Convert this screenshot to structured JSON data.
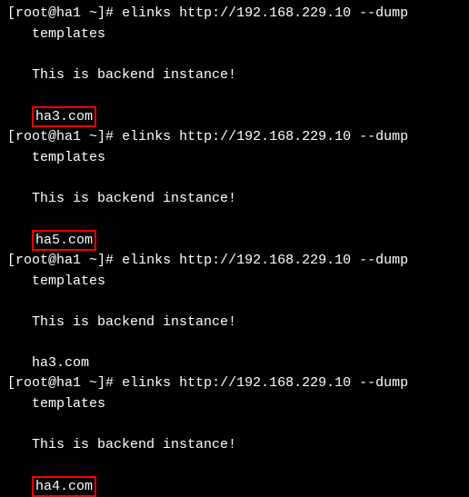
{
  "prompt": {
    "open_bracket": "[",
    "user_host": "root@ha1 ~",
    "close_bracket": "]#",
    "command": "elinks http://192.168.229.10 --dump"
  },
  "blocks": [
    {
      "line1": "templates",
      "line2": "This is backend instance!",
      "host": "ha3.com",
      "highlighted": true
    },
    {
      "line1": "templates",
      "line2": "This is backend instance!",
      "host": "ha5.com",
      "highlighted": true
    },
    {
      "line1": "templates",
      "line2": "This is backend instance!",
      "host": "ha3.com",
      "highlighted": false
    },
    {
      "line1": "templates",
      "line2": "This is backend instance!",
      "host": "ha4.com",
      "highlighted": true
    }
  ]
}
